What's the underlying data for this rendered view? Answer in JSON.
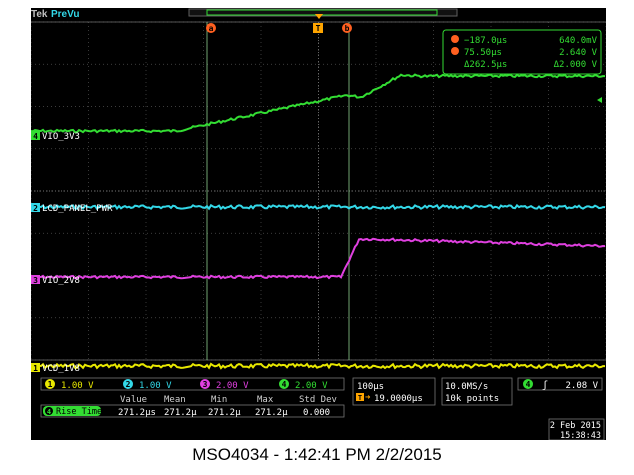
{
  "status": {
    "brand": "Tek",
    "mode": "PreVu"
  },
  "colors": {
    "ch1": "#e8e800",
    "ch2": "#33d8e8",
    "ch3": "#e040e0",
    "ch4": "#33dd33",
    "cursor": "#ff6020",
    "trigger": "#ffa500"
  },
  "cursor_markers": {
    "a": "a",
    "b": "b",
    "trigger": "T"
  },
  "channels": [
    {
      "num": "4",
      "name": "VIO_3V3"
    },
    {
      "num": "2",
      "name": "LCD_PANEL_PWR"
    },
    {
      "num": "3",
      "name": "VIO_2V8"
    },
    {
      "num": "1",
      "name": "VCD_1V8"
    }
  ],
  "readout": {
    "a_time": "−187.0μs",
    "a_val": "640.0mV",
    "b_time": "75.50μs",
    "b_val": "2.640 V",
    "d_time": "Δ262.5μs",
    "d_val": "Δ2.000 V"
  },
  "scales": [
    {
      "num": "1",
      "value": "1.00 V"
    },
    {
      "num": "2",
      "value": "1.00 V"
    },
    {
      "num": "3",
      "value": "2.00 V"
    },
    {
      "num": "4",
      "value": "2.00 V"
    }
  ],
  "measurement": {
    "channel": "4",
    "name": "Rise Time",
    "headers": [
      "Value",
      "Mean",
      "Min",
      "Max",
      "Std Dev"
    ],
    "values": [
      "271.2μs",
      "271.2μ",
      "271.2μ",
      "271.2μ",
      "0.000"
    ]
  },
  "horizontal": {
    "scale": "100μs",
    "position": "19.0000μs"
  },
  "acquisition": {
    "rate": "10.0MS/s",
    "points": "10k points"
  },
  "trigger": {
    "channel": "4",
    "slope": "ʃ",
    "level": "2.08 V"
  },
  "datetime": {
    "date": "2 Feb  2015",
    "time": "15:38:43"
  },
  "caption": "MSO4034 - 1:42:41 PM   2/2/2015"
}
